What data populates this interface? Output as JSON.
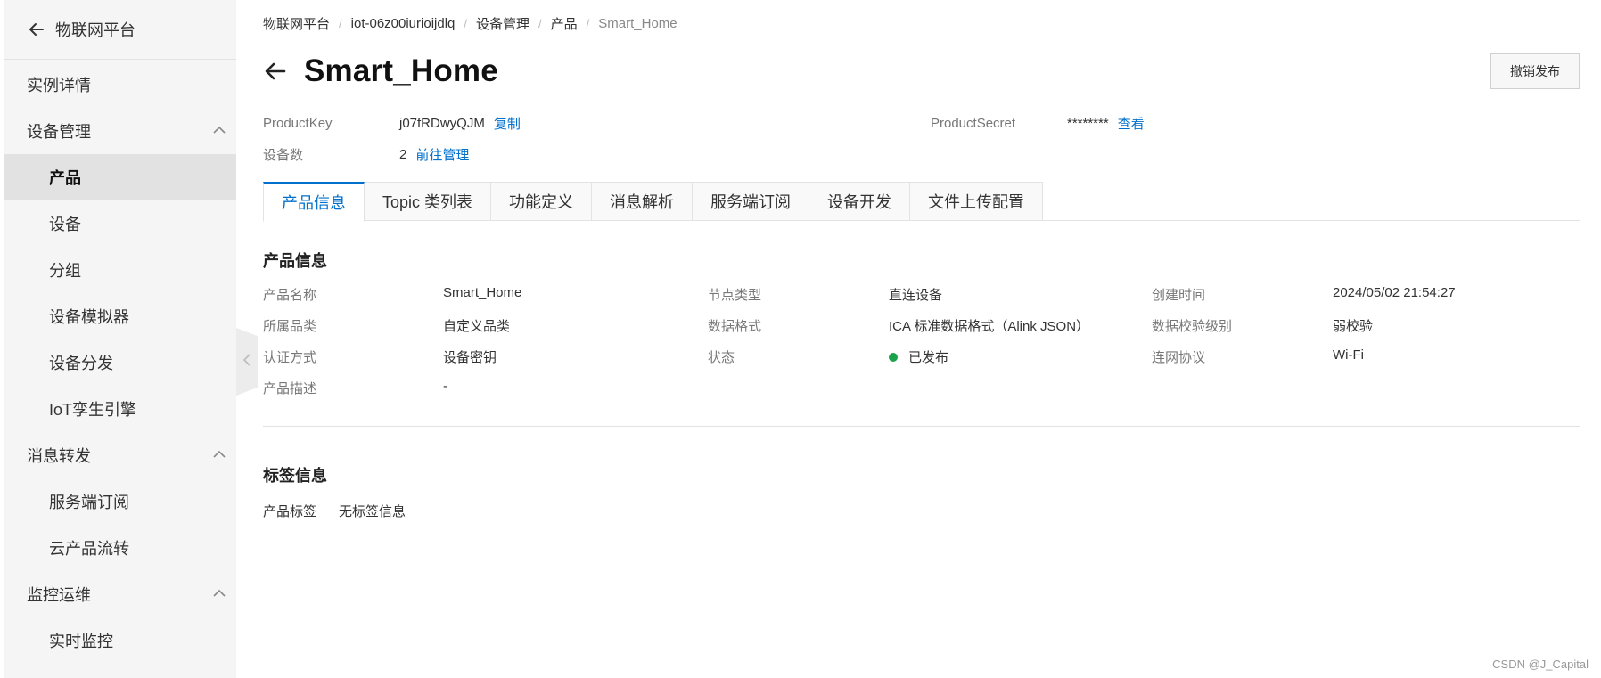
{
  "sidebar": {
    "title": "物联网平台",
    "items": [
      {
        "label": "实例详情"
      },
      {
        "label": "设备管理"
      },
      {
        "label": "产品"
      },
      {
        "label": "设备"
      },
      {
        "label": "分组"
      },
      {
        "label": "设备模拟器"
      },
      {
        "label": "设备分发"
      },
      {
        "label": "IoT孪生引擎"
      },
      {
        "label": "消息转发"
      },
      {
        "label": "服务端订阅"
      },
      {
        "label": "云产品流转"
      },
      {
        "label": "监控运维"
      },
      {
        "label": "实时监控"
      }
    ]
  },
  "breadcrumb": [
    "物联网平台",
    "iot-06z00iurioijdlq",
    "设备管理",
    "产品",
    "Smart_Home"
  ],
  "header": {
    "title": "Smart_Home",
    "revoke_label": "撤销发布"
  },
  "meta": {
    "product_key_label": "ProductKey",
    "product_key_value": "j07fRDwyQJM",
    "copy_label": "复制",
    "product_secret_label": "ProductSecret",
    "product_secret_value": "********",
    "view_label": "查看",
    "device_count_label": "设备数",
    "device_count_value": "2",
    "manage_label": "前往管理"
  },
  "tabs": [
    {
      "label": "产品信息"
    },
    {
      "label": "Topic 类列表"
    },
    {
      "label": "功能定义"
    },
    {
      "label": "消息解析"
    },
    {
      "label": "服务端订阅"
    },
    {
      "label": "设备开发"
    },
    {
      "label": "文件上传配置"
    }
  ],
  "product_info": {
    "section_title": "产品信息",
    "rows": [
      [
        {
          "label": "产品名称",
          "value": "Smart_Home"
        },
        {
          "label": "节点类型",
          "value": "直连设备"
        },
        {
          "label": "创建时间",
          "value": "2024/05/02 21:54:27"
        }
      ],
      [
        {
          "label": "所属品类",
          "value": "自定义品类"
        },
        {
          "label": "数据格式",
          "value": "ICA 标准数据格式（Alink JSON）"
        },
        {
          "label": "数据校验级别",
          "value": "弱校验"
        }
      ],
      [
        {
          "label": "认证方式",
          "value": "设备密钥"
        },
        {
          "label": "状态",
          "value": "已发布"
        },
        {
          "label": "连网协议",
          "value": "Wi-Fi"
        }
      ],
      [
        {
          "label": "产品描述",
          "value": "-"
        }
      ]
    ]
  },
  "tag_info": {
    "section_title": "标签信息",
    "label": "产品标签",
    "value": "无标签信息"
  },
  "watermark": "CSDN @J_Capital",
  "colors": {
    "accent": "#0070cc",
    "status_published": "#1aa34a",
    "sidebar_bg": "#f5f5f5",
    "active_item_bg": "#e2e2e2"
  }
}
